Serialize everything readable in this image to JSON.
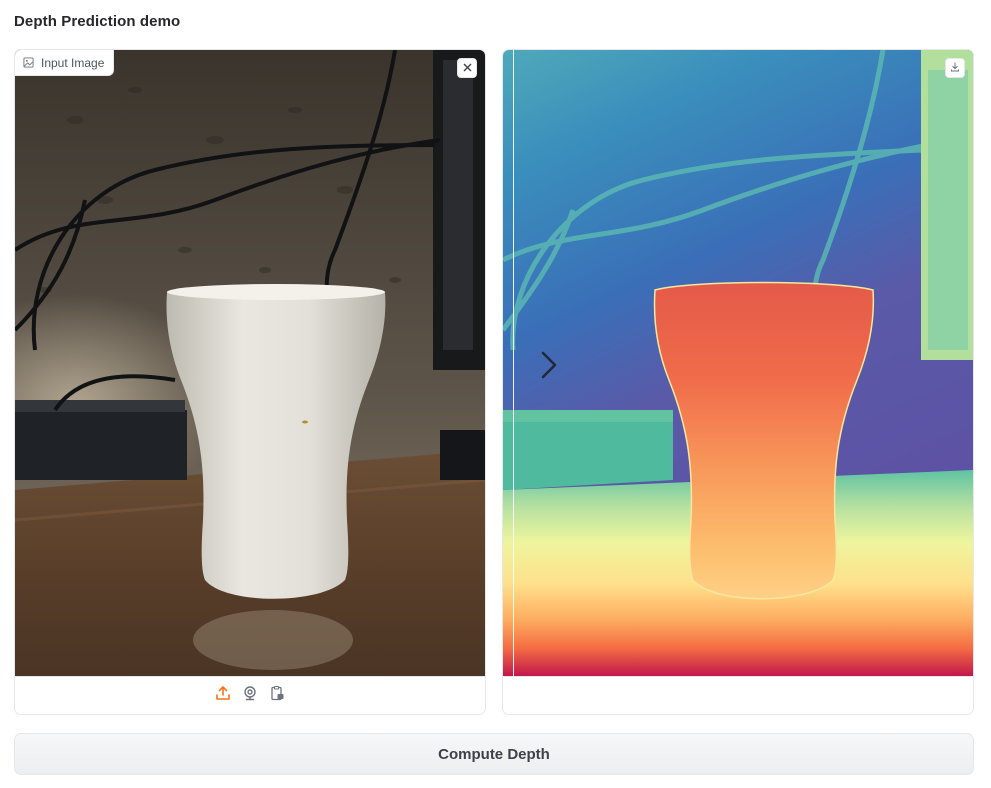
{
  "app": {
    "title": "Depth Prediction demo"
  },
  "input_panel": {
    "label": "Input Image",
    "label_icon": "image-icon",
    "clear_icon": "close-icon",
    "sources": [
      {
        "name": "upload",
        "icon": "upload-icon",
        "active": true
      },
      {
        "name": "webcam",
        "icon": "webcam-icon",
        "active": false
      },
      {
        "name": "clipboard",
        "icon": "clipboard-icon",
        "active": false
      }
    ]
  },
  "output_panel": {
    "download_icon": "download-icon",
    "slider_icon": "chevron-right-icon"
  },
  "actions": {
    "compute_label": "Compute Depth"
  },
  "colors": {
    "accent": "#f97316",
    "border": "#e5e7eb",
    "button_bg": "#f3f4f6"
  }
}
